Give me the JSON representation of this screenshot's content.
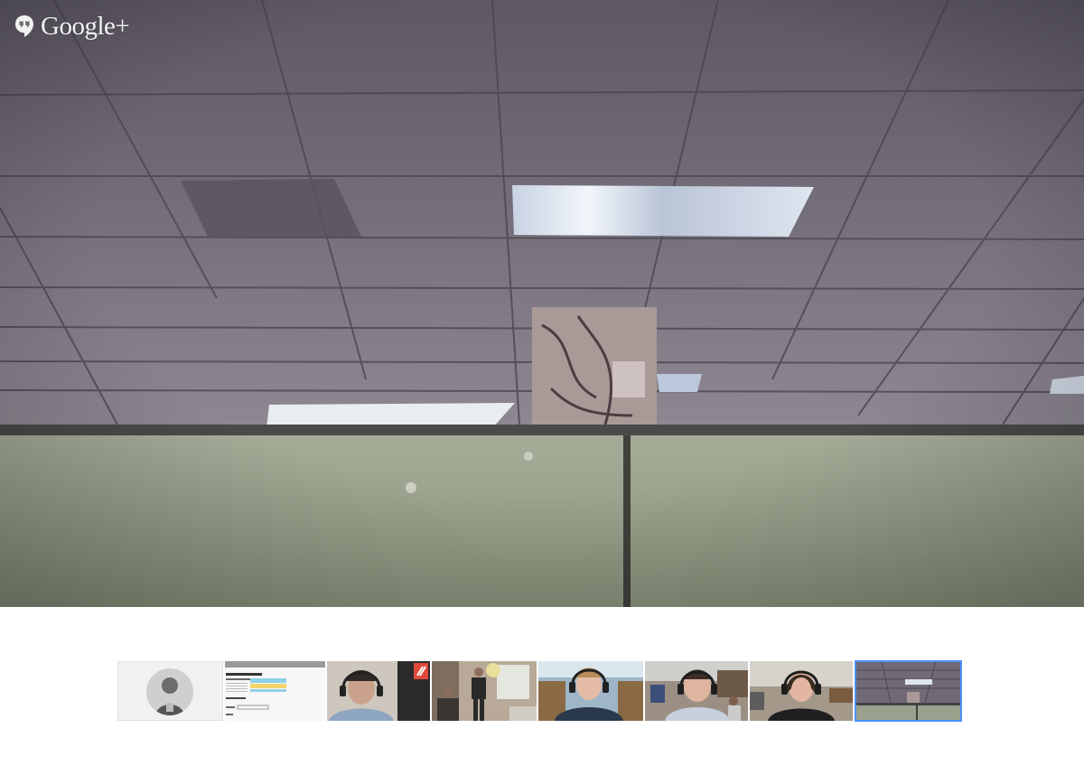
{
  "app": {
    "brand": "Google+",
    "brand_icon": "hangouts-icon",
    "accent_color": "#4d90fe"
  },
  "main_video": {
    "participant_index": 7,
    "scene": "office-ceiling-cubicle"
  },
  "filmstrip": {
    "participants": [
      {
        "kind": "avatar",
        "icon": "profile-photo"
      },
      {
        "kind": "screenshare",
        "icon": "shared-screen"
      },
      {
        "kind": "video",
        "icon": "participant-headset"
      },
      {
        "kind": "video",
        "icon": "participant-room"
      },
      {
        "kind": "video",
        "icon": "participant-headset"
      },
      {
        "kind": "video",
        "icon": "participant-headset"
      },
      {
        "kind": "video",
        "icon": "participant-headset"
      },
      {
        "kind": "video",
        "icon": "ceiling-camera",
        "active": true
      }
    ]
  }
}
